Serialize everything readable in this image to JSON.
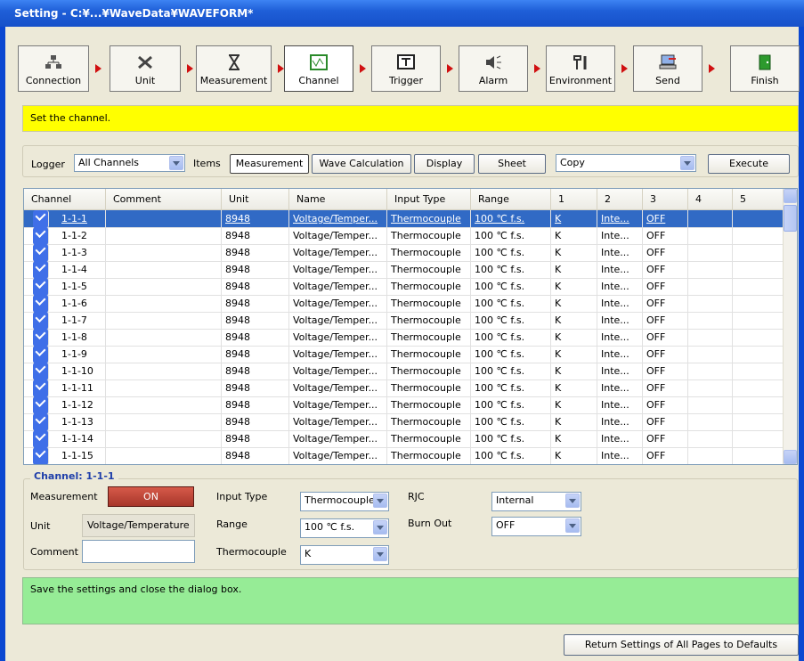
{
  "window": {
    "title": "Setting - C:¥...¥WaveData¥WAVEFORM*"
  },
  "steps": [
    {
      "label": "Connection",
      "icon": "connection-icon"
    },
    {
      "label": "Unit",
      "icon": "unit-icon"
    },
    {
      "label": "Measurement",
      "icon": "hourglass-icon"
    },
    {
      "label": "Channel",
      "icon": "channel-wave-icon"
    },
    {
      "label": "Trigger",
      "icon": "trigger-icon"
    },
    {
      "label": "Alarm",
      "icon": "alarm-speaker-icon"
    },
    {
      "label": "Environment",
      "icon": "tools-icon"
    },
    {
      "label": "Send",
      "icon": "send-icon"
    },
    {
      "label": "Finish",
      "icon": "door-exit-icon"
    }
  ],
  "info_message": "Set the channel.",
  "filter": {
    "logger_label": "Logger",
    "logger_value": "All Channels",
    "items_label": "Items",
    "tabs": [
      "Measurement",
      "Wave Calculation",
      "Display",
      "Sheet"
    ],
    "action_value": "Copy",
    "execute_label": "Execute"
  },
  "table": {
    "headers": [
      "Channel",
      "Comment",
      "Unit",
      "Name",
      "Input Type",
      "Range",
      "1",
      "2",
      "3",
      "4",
      "5"
    ],
    "rows": [
      [
        "1-1-1",
        "",
        "8948",
        "Voltage/Temper...",
        "Thermocouple",
        "100 ℃ f.s.",
        "K",
        "Inte...",
        "OFF",
        "",
        ""
      ],
      [
        "1-1-2",
        "",
        "8948",
        "Voltage/Temper...",
        "Thermocouple",
        "100 ℃ f.s.",
        "K",
        "Inte...",
        "OFF",
        "",
        ""
      ],
      [
        "1-1-3",
        "",
        "8948",
        "Voltage/Temper...",
        "Thermocouple",
        "100 ℃ f.s.",
        "K",
        "Inte...",
        "OFF",
        "",
        ""
      ],
      [
        "1-1-4",
        "",
        "8948",
        "Voltage/Temper...",
        "Thermocouple",
        "100 ℃ f.s.",
        "K",
        "Inte...",
        "OFF",
        "",
        ""
      ],
      [
        "1-1-5",
        "",
        "8948",
        "Voltage/Temper...",
        "Thermocouple",
        "100 ℃ f.s.",
        "K",
        "Inte...",
        "OFF",
        "",
        ""
      ],
      [
        "1-1-6",
        "",
        "8948",
        "Voltage/Temper...",
        "Thermocouple",
        "100 ℃ f.s.",
        "K",
        "Inte...",
        "OFF",
        "",
        ""
      ],
      [
        "1-1-7",
        "",
        "8948",
        "Voltage/Temper...",
        "Thermocouple",
        "100 ℃ f.s.",
        "K",
        "Inte...",
        "OFF",
        "",
        ""
      ],
      [
        "1-1-8",
        "",
        "8948",
        "Voltage/Temper...",
        "Thermocouple",
        "100 ℃ f.s.",
        "K",
        "Inte...",
        "OFF",
        "",
        ""
      ],
      [
        "1-1-9",
        "",
        "8948",
        "Voltage/Temper...",
        "Thermocouple",
        "100 ℃ f.s.",
        "K",
        "Inte...",
        "OFF",
        "",
        ""
      ],
      [
        "1-1-10",
        "",
        "8948",
        "Voltage/Temper...",
        "Thermocouple",
        "100 ℃ f.s.",
        "K",
        "Inte...",
        "OFF",
        "",
        ""
      ],
      [
        "1-1-11",
        "",
        "8948",
        "Voltage/Temper...",
        "Thermocouple",
        "100 ℃ f.s.",
        "K",
        "Inte...",
        "OFF",
        "",
        ""
      ],
      [
        "1-1-12",
        "",
        "8948",
        "Voltage/Temper...",
        "Thermocouple",
        "100 ℃ f.s.",
        "K",
        "Inte...",
        "OFF",
        "",
        ""
      ],
      [
        "1-1-13",
        "",
        "8948",
        "Voltage/Temper...",
        "Thermocouple",
        "100 ℃ f.s.",
        "K",
        "Inte...",
        "OFF",
        "",
        ""
      ],
      [
        "1-1-14",
        "",
        "8948",
        "Voltage/Temper...",
        "Thermocouple",
        "100 ℃ f.s.",
        "K",
        "Inte...",
        "OFF",
        "",
        ""
      ],
      [
        "1-1-15",
        "",
        "8948",
        "Voltage/Temper...",
        "Thermocouple",
        "100 ℃ f.s.",
        "K",
        "Inte...",
        "OFF",
        "",
        ""
      ]
    ]
  },
  "channel_panel": {
    "title": "Channel: 1-1-1",
    "measurement_label": "Measurement",
    "measurement_value": "ON",
    "unit_label": "Unit",
    "unit_value": "Voltage/Temperature",
    "comment_label": "Comment",
    "comment_value": "",
    "input_type_label": "Input Type",
    "input_type_value": "Thermocouple",
    "range_label": "Range",
    "range_value": "100 ℃ f.s.",
    "thermocouple_label": "Thermocouple",
    "thermocouple_value": "K",
    "rjc_label": "RJC",
    "rjc_value": "Internal",
    "burnout_label": "Burn Out",
    "burnout_value": "OFF"
  },
  "status_message": "Save the settings and close the dialog box.",
  "defaults_button": "Return Settings of All Pages to Defaults",
  "colors": {
    "info_bg": "#ffff00",
    "status_bg": "#96ec96",
    "selection": "#316ac5",
    "on_button": "#b6402f"
  }
}
